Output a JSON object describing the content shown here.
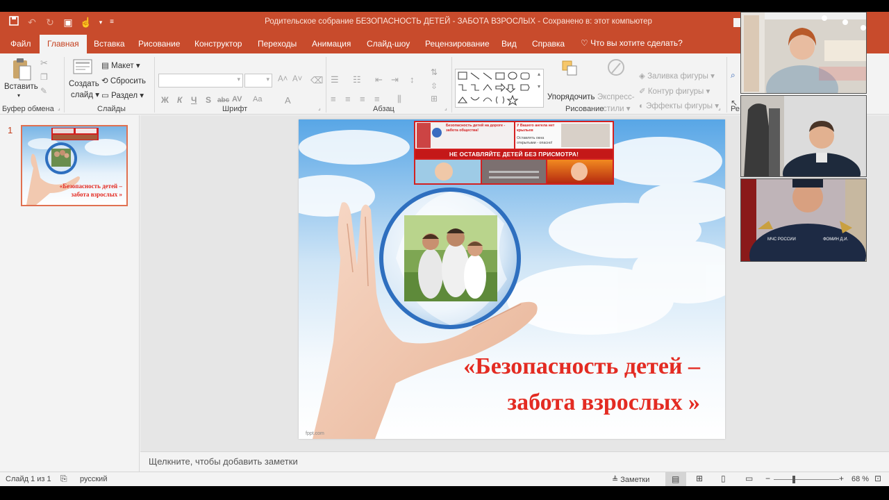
{
  "window": {
    "title": "Родительское собрание БЕЗОПАСНОСТЬ ДЕТЕЙ - ЗАБОТА ВЗРОСЛЫХ  -  Сохранено в: этот компьютер"
  },
  "tabs": [
    {
      "label": "Файл",
      "active": false
    },
    {
      "label": "Главная",
      "active": true
    },
    {
      "label": "Вставка",
      "active": false
    },
    {
      "label": "Рисование",
      "active": false
    },
    {
      "label": "Конструктор",
      "active": false
    },
    {
      "label": "Переходы",
      "active": false
    },
    {
      "label": "Анимация",
      "active": false
    },
    {
      "label": "Слайд-шоу",
      "active": false
    },
    {
      "label": "Рецензирование",
      "active": false
    },
    {
      "label": "Вид",
      "active": false
    },
    {
      "label": "Справка",
      "active": false
    }
  ],
  "tell_me": "Что вы хотите сделать?",
  "ribbon": {
    "clipboard": {
      "paste": "Вставить",
      "label": "Буфер обмена"
    },
    "slides": {
      "new_slide_1": "Создать",
      "new_slide_2": "слайд",
      "layout": "Макет",
      "reset": "Сбросить",
      "section": "Раздел",
      "label": "Слайды"
    },
    "font": {
      "label": "Шрифт",
      "bold": "Ж",
      "italic": "К",
      "underline": "Ч",
      "shadow": "S",
      "strike": "abc",
      "spacing": "AV",
      "case": "Aa"
    },
    "paragraph": {
      "label": "Абзац"
    },
    "drawing": {
      "arrange": "Упорядочить",
      "quick_styles_1": "Экспресс-",
      "quick_styles_2": "стили",
      "fill": "Заливка фигуры",
      "outline": "Контур фигуры",
      "effects": "Эффекты фигуры",
      "label": "Рисование"
    },
    "editing": {
      "label": "Ре"
    }
  },
  "slides_pane": {
    "slide_number": "1",
    "thumb_title_1": "«Безопасность детей –",
    "thumb_title_2": "забота взрослых »"
  },
  "slide": {
    "title_line1": "«Безопасность детей –",
    "title_line2": "забота взрослых »",
    "banner_text": "НЕ ОСТАВЛЯЙТЕ ДЕТЕЙ БЕЗ ПРИСМОТРА!",
    "banner_left": "Безопасность детей на дороге - забота общества!",
    "banner_right_1": "У Вашего ангела нет крыльев",
    "banner_right_2": "Оставлять окна открытыми - опасно!",
    "footer": "fppt.com"
  },
  "notes": {
    "placeholder": "Щелкните, чтобы добавить заметки"
  },
  "status": {
    "slide_info": "Слайд 1 из 1",
    "language": "русский",
    "notes_btn": "Заметки",
    "zoom": "68 %"
  },
  "video": {
    "badge_1": "МЧС РОССИИ",
    "badge_2": "ФОМИН Д.И."
  },
  "colors": {
    "accent": "#c84b2c",
    "title_red": "#e32b22"
  }
}
